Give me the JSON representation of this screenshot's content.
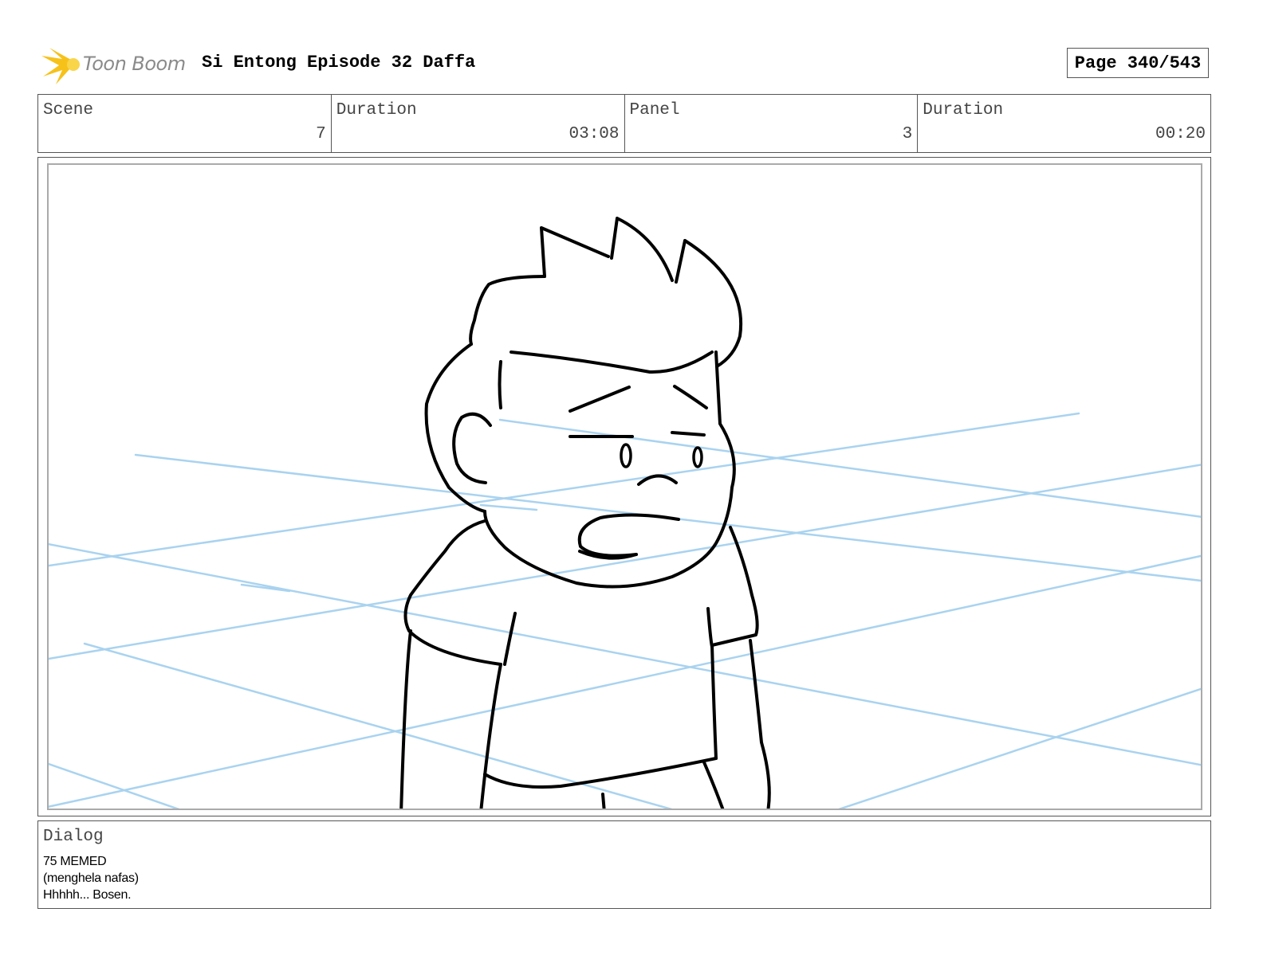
{
  "header": {
    "logo_text": "Toon Boom",
    "title": "Si Entong Episode 32 Daffa",
    "page": "Page 340/543"
  },
  "info": {
    "scene_label": "Scene",
    "scene_value": "7",
    "scene_duration_label": "Duration",
    "scene_duration_value": "03:08",
    "panel_label": "Panel",
    "panel_value": "3",
    "panel_duration_label": "Duration",
    "panel_duration_value": "00:20"
  },
  "dialog": {
    "label": "Dialog",
    "lines": [
      "75 MEMED",
      "(menghela nafas)",
      "Hhhhh... Bosen."
    ]
  },
  "colors": {
    "guide_lines": "#a9d3ef",
    "logo_star": "#f6c21a",
    "logo_text": "#8a8a8a"
  }
}
